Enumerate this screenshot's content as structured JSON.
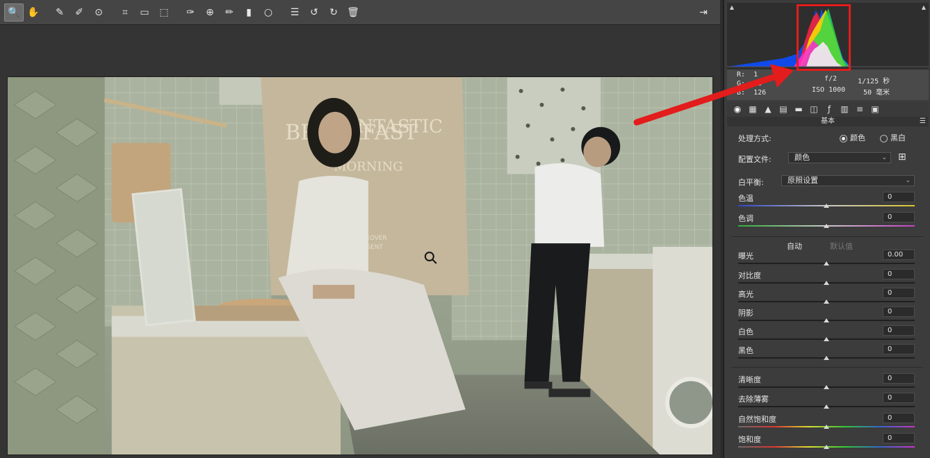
{
  "toolbar": {
    "tools": [
      {
        "name": "zoom-tool",
        "icon": "🔍"
      },
      {
        "name": "hand-tool",
        "icon": "✋"
      },
      {
        "name": "white-balance-tool",
        "icon": "✎"
      },
      {
        "name": "color-sampler-tool",
        "icon": "✐"
      },
      {
        "name": "targeted-adjustment-tool",
        "icon": "⊙"
      },
      {
        "name": "crop-tool",
        "icon": "⌗"
      },
      {
        "name": "straighten-tool",
        "icon": "▭"
      },
      {
        "name": "transform-tool",
        "icon": "⬚"
      },
      {
        "name": "spot-removal-tool",
        "icon": "✑"
      },
      {
        "name": "red-eye-tool",
        "icon": "⊕"
      },
      {
        "name": "adjustment-brush-tool",
        "icon": "✏"
      },
      {
        "name": "graduated-filter-tool",
        "icon": "▮"
      },
      {
        "name": "radial-filter-tool",
        "icon": "○"
      },
      {
        "name": "preferences-tool",
        "icon": "☰"
      },
      {
        "name": "rotate-left-tool",
        "icon": "↺"
      },
      {
        "name": "rotate-right-tool",
        "icon": "↻"
      },
      {
        "name": "delete-tool",
        "icon": "🗑"
      }
    ],
    "exit_icon": "⇥"
  },
  "camera_info": {
    "r_label": "R:",
    "r_value": "1",
    "g_label": "G:",
    "g_value": "13",
    "b_label": "B:",
    "b_value": "126",
    "aperture": "f/2",
    "shutter": "1/125 秒",
    "iso": "ISO 1000",
    "focal": "50 毫米"
  },
  "panel": {
    "title": "基本",
    "treatment_label": "处理方式:",
    "treatment_color": "颜色",
    "treatment_bw": "黑白",
    "profile_label": "配置文件:",
    "profile_value": "颜色",
    "wb_label": "白平衡:",
    "wb_value": "原照设置",
    "auto_label": "自动",
    "default_label": "默认值",
    "sliders": [
      {
        "id": "temp",
        "label": "色温",
        "value": "0",
        "pos": 0.5
      },
      {
        "id": "tint",
        "label": "色调",
        "value": "0",
        "pos": 0.5
      },
      {
        "id": "exposure",
        "label": "曝光",
        "value": "0.00",
        "pos": 0.5
      },
      {
        "id": "contrast",
        "label": "对比度",
        "value": "0",
        "pos": 0.5
      },
      {
        "id": "highlights",
        "label": "高光",
        "value": "0",
        "pos": 0.5
      },
      {
        "id": "shadows",
        "label": "阴影",
        "value": "0",
        "pos": 0.5
      },
      {
        "id": "whites",
        "label": "白色",
        "value": "0",
        "pos": 0.5
      },
      {
        "id": "blacks",
        "label": "黑色",
        "value": "0",
        "pos": 0.5
      },
      {
        "id": "clarity",
        "label": "清晰度",
        "value": "0",
        "pos": 0.5
      },
      {
        "id": "dehaze",
        "label": "去除薄雾",
        "value": "0",
        "pos": 0.5
      },
      {
        "id": "vibrance",
        "label": "自然饱和度",
        "value": "0",
        "pos": 0.5
      },
      {
        "id": "saturation",
        "label": "饱和度",
        "value": "0",
        "pos": 0.5
      }
    ]
  },
  "photo": {
    "poster_line1": "FANTASTIC",
    "poster_line2": "BREAKFAST",
    "poster_line3": "MORNING",
    "poster_line4": "MOREOVER",
    "poster_line5": "PRESENT"
  },
  "colors": {
    "annotation": "#e31c1c",
    "panel_bg": "#3c3c3c",
    "toolbar_bg": "#454545"
  }
}
